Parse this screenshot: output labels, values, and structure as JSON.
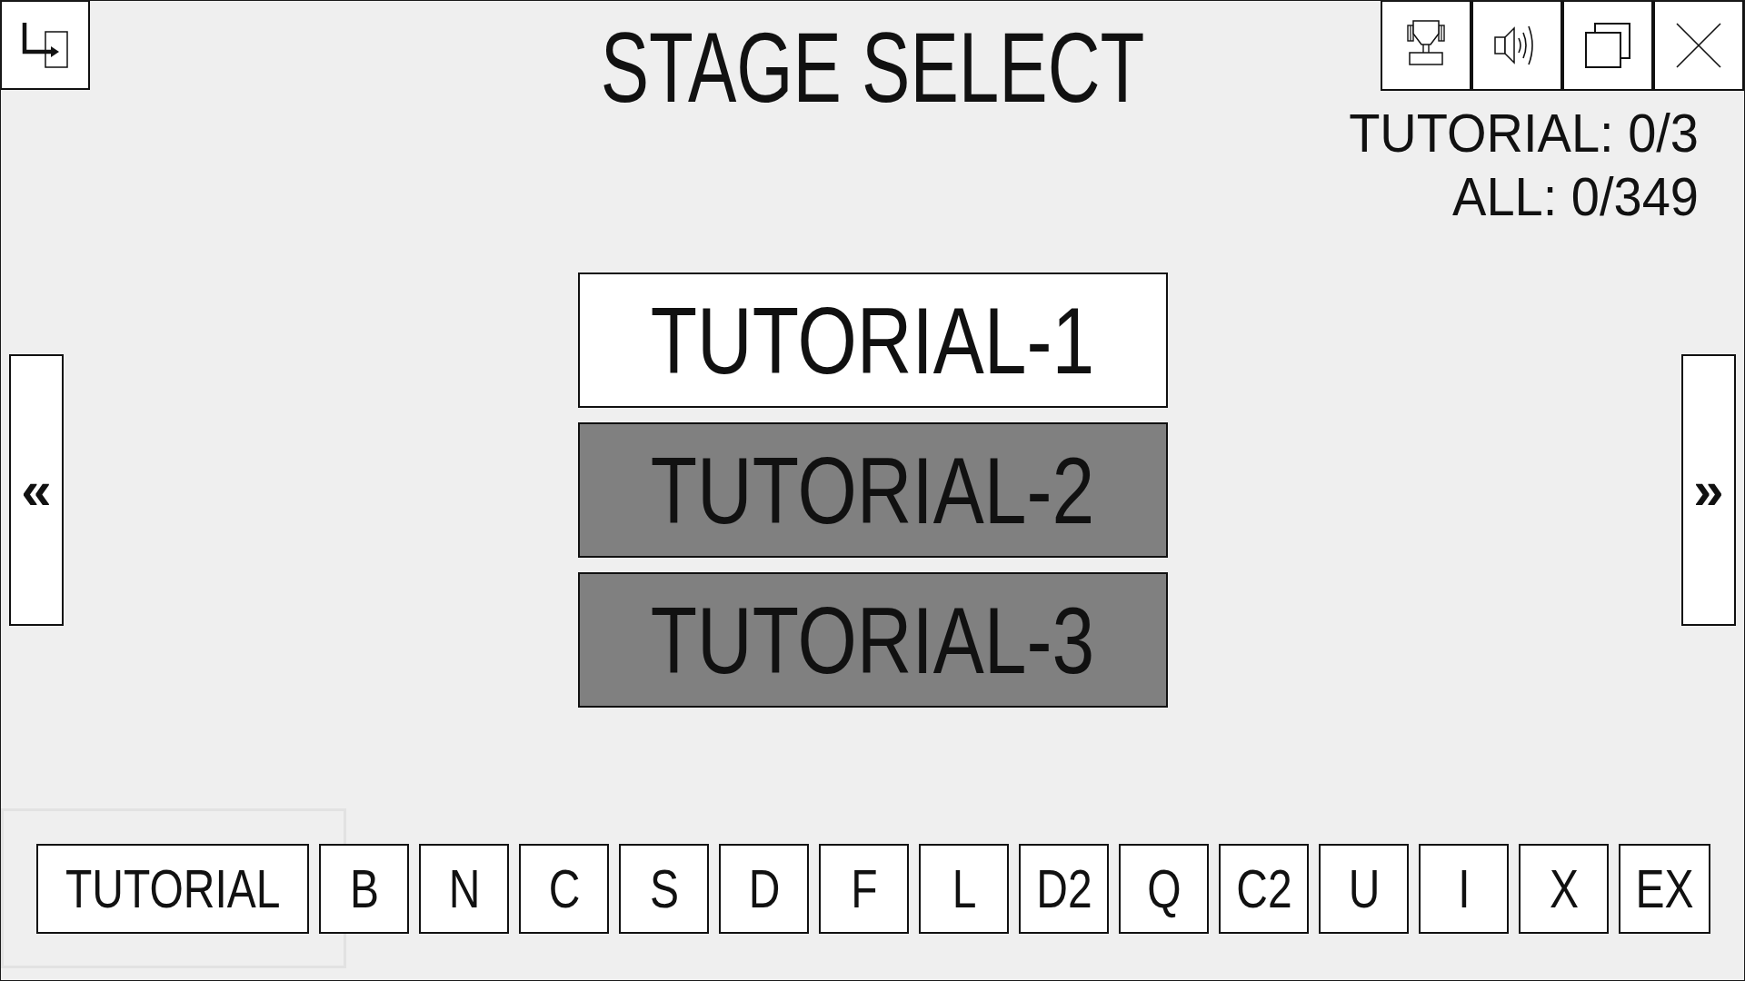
{
  "title": "STAGE SELECT",
  "progress": [
    "TUTORIAL: 0/3",
    "ALL: 0/349"
  ],
  "stage_nav": {
    "previous": "«",
    "next": "»"
  },
  "stages": [
    {
      "label": "TUTORIAL-1",
      "locked": false
    },
    {
      "label": "TUTORIAL-2",
      "locked": true
    },
    {
      "label": "TUTORIAL-3",
      "locked": true
    }
  ],
  "category_tabs": [
    {
      "label": "TUTORIAL",
      "selected": true
    },
    {
      "label": "B",
      "selected": false
    },
    {
      "label": "N",
      "selected": false
    },
    {
      "label": "C",
      "selected": false
    },
    {
      "label": "S",
      "selected": false
    },
    {
      "label": "D",
      "selected": false
    },
    {
      "label": "F",
      "selected": false
    },
    {
      "label": "L",
      "selected": false
    },
    {
      "label": "D2",
      "selected": false
    },
    {
      "label": "Q",
      "selected": false
    },
    {
      "label": "C2",
      "selected": false
    },
    {
      "label": "U",
      "selected": false
    },
    {
      "label": "I",
      "selected": false
    },
    {
      "label": "X",
      "selected": false
    },
    {
      "label": "EX",
      "selected": false
    }
  ]
}
